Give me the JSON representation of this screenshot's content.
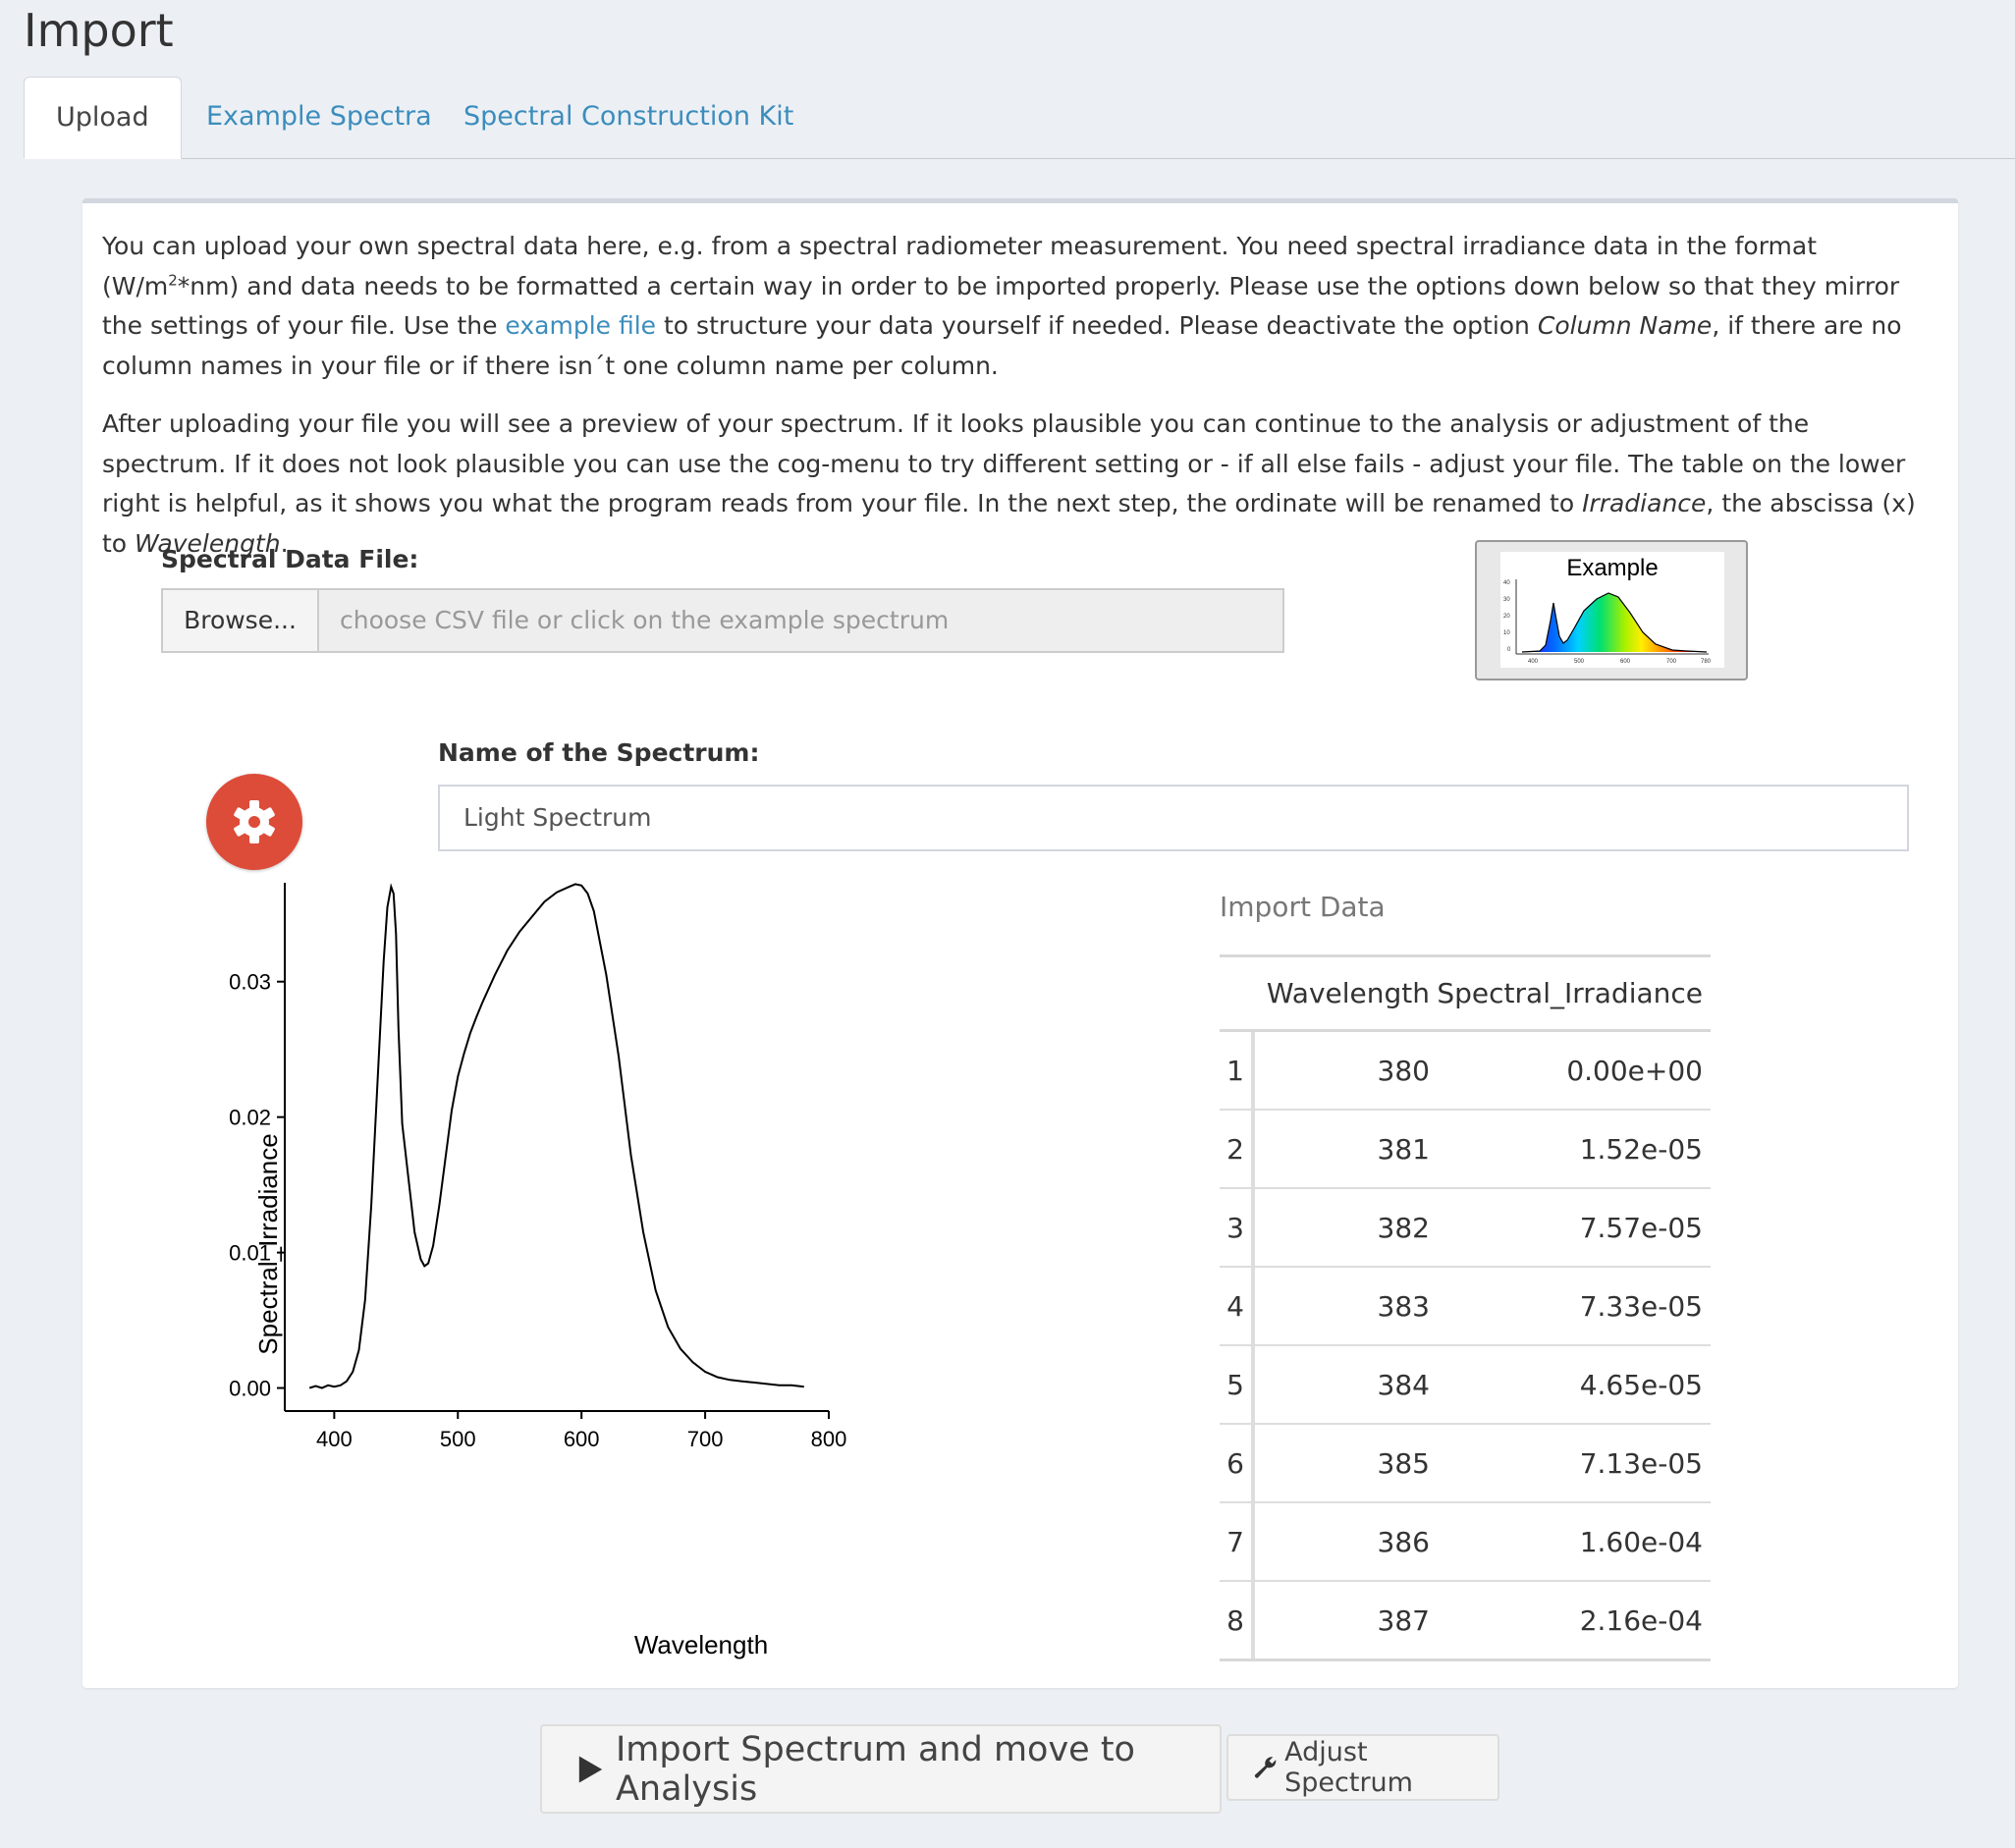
{
  "page": {
    "title": "Import"
  },
  "tabs": [
    {
      "label": "Upload",
      "active": true
    },
    {
      "label": "Example Spectra",
      "active": false
    },
    {
      "label": "Spectral Construction Kit",
      "active": false
    }
  ],
  "intro": {
    "p1_part1": "You can upload your own spectral data here, e.g. from a spectral radiometer measurement. You need spectral irradiance data in the format (W/m",
    "p1_sup": "2",
    "p1_part2": "*nm) and data needs to be formatted a certain way in order to be imported properly. Please use the options down below so that they mirror the settings of your file. Use the ",
    "p1_link": "example file",
    "p1_part3": " to structure your data yourself if needed. Please deactivate the option ",
    "p1_em": "Column Name",
    "p1_part4": ", if there are no column names in your file or if there isn´t one column name per column.",
    "p2_part1": "After uploading your file you will see a preview of your spectrum. If it looks plausible you can continue to the analysis or adjustment of the spectrum. If it does not look plausible you can use the cog-menu to try different setting or - if all else fails - adjust your file. The table on the lower right is helpful, as it shows you what the program reads from your file. In the next step, the ordinate will be renamed to ",
    "p2_em1": "Irradiance",
    "p2_part2": ", the abscissa (x) to ",
    "p2_em2": "Wavelength",
    "p2_part3": "."
  },
  "file_input": {
    "label": "Spectral Data File:",
    "browse_label": "Browse...",
    "placeholder": "choose CSV file or click on the example spectrum"
  },
  "example": {
    "title": "Example",
    "y_ticks": [
      "40",
      "30",
      "20",
      "10",
      "0"
    ],
    "x_ticks": [
      "400",
      "500",
      "600",
      "700",
      "780"
    ]
  },
  "spectrum_name": {
    "label": "Name of the Spectrum:",
    "value": "Light Spectrum"
  },
  "chart_data": {
    "type": "line",
    "title": "",
    "xlabel": "Wavelength",
    "ylabel": "Spectral_Irradiance",
    "xlim": [
      360,
      800
    ],
    "ylim": [
      -0.0017,
      0.0373
    ],
    "x_ticks": [
      "400",
      "500",
      "600",
      "700",
      "800"
    ],
    "y_ticks": [
      "0.00",
      "0.01",
      "0.02",
      "0.03"
    ],
    "grid": false,
    "series": [
      {
        "x": [
          380,
          385,
          390,
          395,
          400,
          405,
          410,
          415,
          420,
          425,
          430,
          435,
          440,
          443,
          446,
          448,
          450,
          452,
          455,
          460,
          465,
          470,
          473,
          476,
          480,
          485,
          490,
          495,
          500,
          505,
          510,
          515,
          520,
          530,
          540,
          550,
          560,
          570,
          580,
          590,
          595,
          600,
          605,
          610,
          620,
          630,
          640,
          650,
          660,
          670,
          680,
          690,
          700,
          710,
          720,
          730,
          740,
          750,
          760,
          770,
          780
        ],
        "y": [
          0.0,
          0.00015,
          0.0,
          0.0002,
          0.0001,
          0.0002,
          0.0005,
          0.0012,
          0.0028,
          0.0065,
          0.0135,
          0.0225,
          0.0315,
          0.0355,
          0.037,
          0.0365,
          0.0335,
          0.0265,
          0.0195,
          0.0155,
          0.0115,
          0.0095,
          0.009,
          0.0092,
          0.0105,
          0.0135,
          0.017,
          0.0205,
          0.023,
          0.0247,
          0.0262,
          0.0274,
          0.0285,
          0.0305,
          0.0323,
          0.0337,
          0.0348,
          0.0359,
          0.0366,
          0.037,
          0.0372,
          0.0371,
          0.0365,
          0.0352,
          0.0305,
          0.0245,
          0.0172,
          0.0115,
          0.0072,
          0.0045,
          0.0029,
          0.0019,
          0.0012,
          0.0008,
          0.0006,
          0.0005,
          0.0004,
          0.0003,
          0.0002,
          0.0002,
          0.0001
        ]
      }
    ]
  },
  "import_table": {
    "caption": "Import Data",
    "columns": [
      "",
      "Wavelength",
      "Spectral_Irradiance"
    ],
    "rows": [
      [
        "1",
        "380",
        "0.00e+00"
      ],
      [
        "2",
        "381",
        "1.52e-05"
      ],
      [
        "3",
        "382",
        "7.57e-05"
      ],
      [
        "4",
        "383",
        "7.33e-05"
      ],
      [
        "5",
        "384",
        "4.65e-05"
      ],
      [
        "6",
        "385",
        "7.13e-05"
      ],
      [
        "7",
        "386",
        "1.60e-04"
      ],
      [
        "8",
        "387",
        "2.16e-04"
      ]
    ]
  },
  "actions": {
    "import_label": "Import Spectrum and move to Analysis",
    "adjust_label": "Adjust Spectrum"
  },
  "colors": {
    "accent": "#3c8dbc",
    "cog": "#dd4b39",
    "background": "#ecf0f5"
  }
}
